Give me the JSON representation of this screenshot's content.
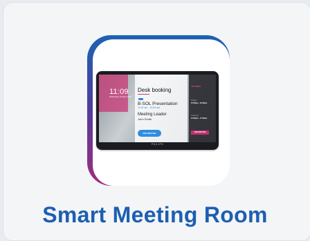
{
  "card": {
    "title": "Smart Meeting Room"
  },
  "device": {
    "brand": "PHILIPS",
    "screen": {
      "clock": "11:09",
      "date": "Wednesday, 23 August 2023",
      "room_name": "Desk booking",
      "now_badge": "NOW",
      "meeting_title": "B-SOL Presentation",
      "meeting_time": "11:00 am - 12:00 am",
      "leader_label": "Meeting Leader",
      "leader_name": "John Smith",
      "end_button": "END MEETING",
      "side_heading": "UPCOMING",
      "side_items": [
        {
          "title": "Project",
          "time": "15:00pm - 16:00pm"
        },
        {
          "title": "Customer",
          "time": "16:00pm - 17:00pm"
        }
      ],
      "join_button": "JOIN MEETING"
    }
  },
  "colors": {
    "title": "#1d5fb1",
    "accent_pink": "#c23c7a",
    "accent_blue": "#2f86d8"
  }
}
